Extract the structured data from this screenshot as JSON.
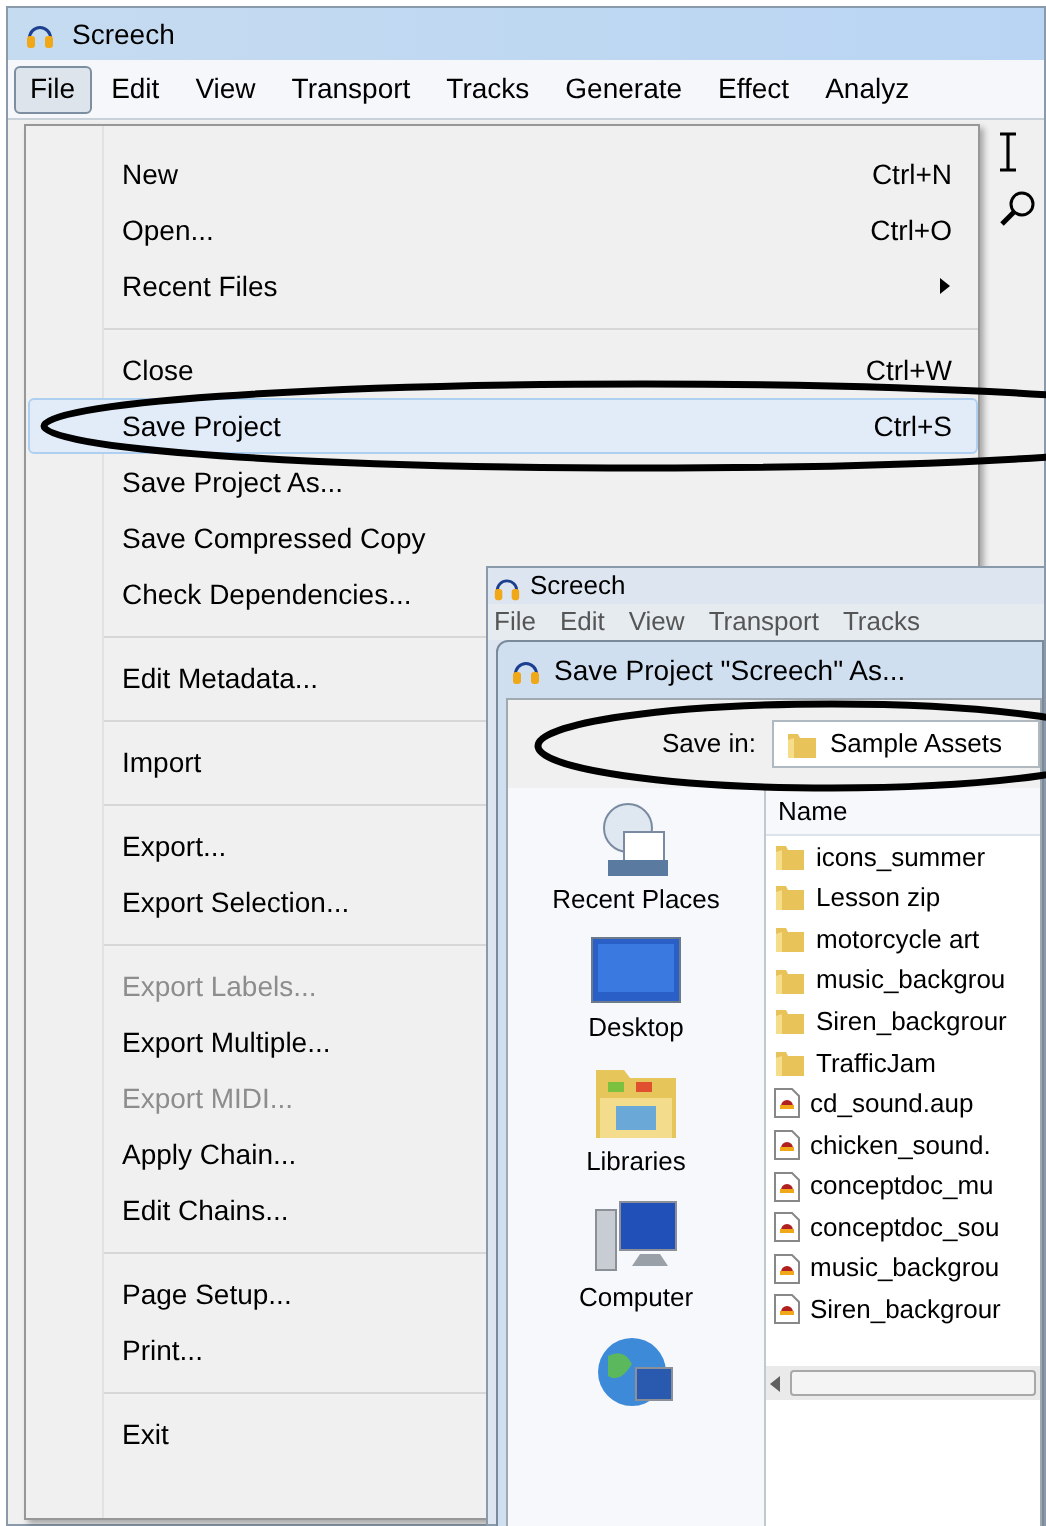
{
  "window": {
    "title": "Screech"
  },
  "menu_bar": [
    {
      "label": "File",
      "selected": true
    },
    {
      "label": "Edit",
      "selected": false
    },
    {
      "label": "View",
      "selected": false
    },
    {
      "label": "Transport",
      "selected": false
    },
    {
      "label": "Tracks",
      "selected": false
    },
    {
      "label": "Generate",
      "selected": false
    },
    {
      "label": "Effect",
      "selected": false
    },
    {
      "label": "Analyz",
      "selected": false
    }
  ],
  "file_menu": [
    {
      "kind": "item",
      "label": "New",
      "shortcut": "Ctrl+N",
      "submenu": false,
      "disabled": false,
      "selected": false
    },
    {
      "kind": "item",
      "label": "Open...",
      "shortcut": "Ctrl+O",
      "submenu": false,
      "disabled": false,
      "selected": false
    },
    {
      "kind": "item",
      "label": "Recent Files",
      "submenu": true,
      "disabled": false,
      "selected": false
    },
    {
      "kind": "separator"
    },
    {
      "kind": "item",
      "label": "Close",
      "shortcut": "Ctrl+W",
      "submenu": false,
      "disabled": false,
      "selected": false
    },
    {
      "kind": "item",
      "label": "Save Project",
      "shortcut": "Ctrl+S",
      "submenu": false,
      "disabled": false,
      "selected": true
    },
    {
      "kind": "item",
      "label": "Save Project As...",
      "submenu": false,
      "disabled": false,
      "selected": false
    },
    {
      "kind": "item",
      "label": "Save Compressed Copy",
      "submenu": false,
      "disabled": false,
      "selected": false
    },
    {
      "kind": "item",
      "label": "Check Dependencies...",
      "disabled": false,
      "selected": false
    },
    {
      "kind": "separator"
    },
    {
      "kind": "item",
      "label": "Edit Metadata...",
      "disabled": false,
      "selected": false
    },
    {
      "kind": "separator"
    },
    {
      "kind": "item",
      "label": "Import",
      "disabled": false,
      "selected": false
    },
    {
      "kind": "separator"
    },
    {
      "kind": "item",
      "label": "Export...",
      "disabled": false,
      "selected": false
    },
    {
      "kind": "item",
      "label": "Export Selection...",
      "disabled": false,
      "selected": false
    },
    {
      "kind": "separator"
    },
    {
      "kind": "item",
      "label": "Export Labels...",
      "disabled": true,
      "selected": false
    },
    {
      "kind": "item",
      "label": "Export Multiple...",
      "disabled": false,
      "selected": false
    },
    {
      "kind": "item",
      "label": "Export MIDI...",
      "disabled": true,
      "selected": false
    },
    {
      "kind": "item",
      "label": "Apply Chain...",
      "disabled": false,
      "selected": false
    },
    {
      "kind": "item",
      "label": "Edit Chains...",
      "disabled": false,
      "selected": false
    },
    {
      "kind": "separator"
    },
    {
      "kind": "item",
      "label": "Page Setup...",
      "disabled": false,
      "selected": false
    },
    {
      "kind": "item",
      "label": "Print...",
      "disabled": false,
      "selected": false
    },
    {
      "kind": "separator"
    },
    {
      "kind": "item",
      "label": "Exit",
      "disabled": false,
      "selected": false
    }
  ],
  "back_window": {
    "title": "Screech",
    "menu_bar": [
      "File",
      "Edit",
      "View",
      "Transport",
      "Tracks"
    ]
  },
  "dialog": {
    "title": "Save Project \"Screech\" As...",
    "save_in_label": "Save in:",
    "save_in_value": "Sample Assets",
    "places": [
      {
        "kind": "recent",
        "label": "Recent Places"
      },
      {
        "kind": "desktop",
        "label": "Desktop"
      },
      {
        "kind": "libraries",
        "label": "Libraries"
      },
      {
        "kind": "computer",
        "label": "Computer"
      },
      {
        "kind": "network"
      }
    ],
    "column": "Name",
    "files": [
      {
        "kind": "folder",
        "name": "icons_summer"
      },
      {
        "kind": "folder",
        "name": "Lesson zip"
      },
      {
        "kind": "folder",
        "name": "motorcycle art"
      },
      {
        "kind": "folder",
        "name": "music_backgrou"
      },
      {
        "kind": "folder",
        "name": "Siren_backgrour"
      },
      {
        "kind": "folder",
        "name": "TrafficJam"
      },
      {
        "kind": "project",
        "name": "cd_sound.aup"
      },
      {
        "kind": "project",
        "name": "chicken_sound."
      },
      {
        "kind": "project",
        "name": "conceptdoc_mu"
      },
      {
        "kind": "project",
        "name": "conceptdoc_sou"
      },
      {
        "kind": "project",
        "name": "music_backgrou"
      },
      {
        "kind": "project",
        "name": "Siren_backgrour"
      }
    ]
  }
}
